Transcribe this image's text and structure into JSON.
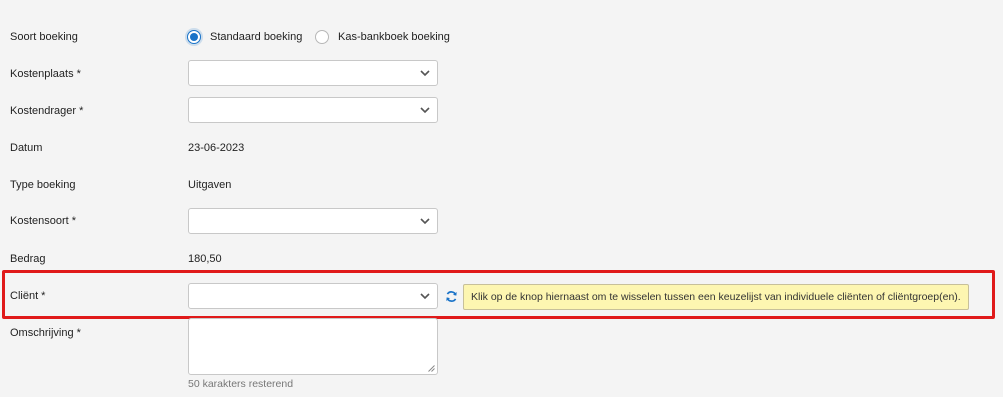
{
  "form": {
    "soort_boeking": {
      "label": "Soort boeking",
      "options": [
        {
          "label": "Standaard boeking",
          "selected": true
        },
        {
          "label": "Kas-bankboek boeking",
          "selected": false
        }
      ]
    },
    "kostenplaats": {
      "label": "Kostenplaats *",
      "value": ""
    },
    "kostendrager": {
      "label": "Kostendrager *",
      "value": ""
    },
    "datum": {
      "label": "Datum",
      "value": "23-06-2023"
    },
    "type_boeking": {
      "label": "Type boeking",
      "value": "Uitgaven"
    },
    "kostensoort": {
      "label": "Kostensoort *",
      "value": ""
    },
    "bedrag": {
      "label": "Bedrag",
      "value": "180,50"
    },
    "client": {
      "label": "Cliënt *",
      "value": "",
      "toggle_icon": "refresh-icon",
      "tooltip": "Klik op de knop hiernaast om te wisselen tussen een keuzelijst van individuele cliënten of cliëntgroep(en)."
    },
    "omschrijving": {
      "label": "Omschrijving *",
      "value": "",
      "helper": "50 karakters resterend"
    }
  },
  "colors": {
    "accent": "#1a73c8",
    "highlight_border": "#e01a1a",
    "tooltip_bg": "#fdf6b1",
    "page_bg": "#f4f4f4"
  }
}
